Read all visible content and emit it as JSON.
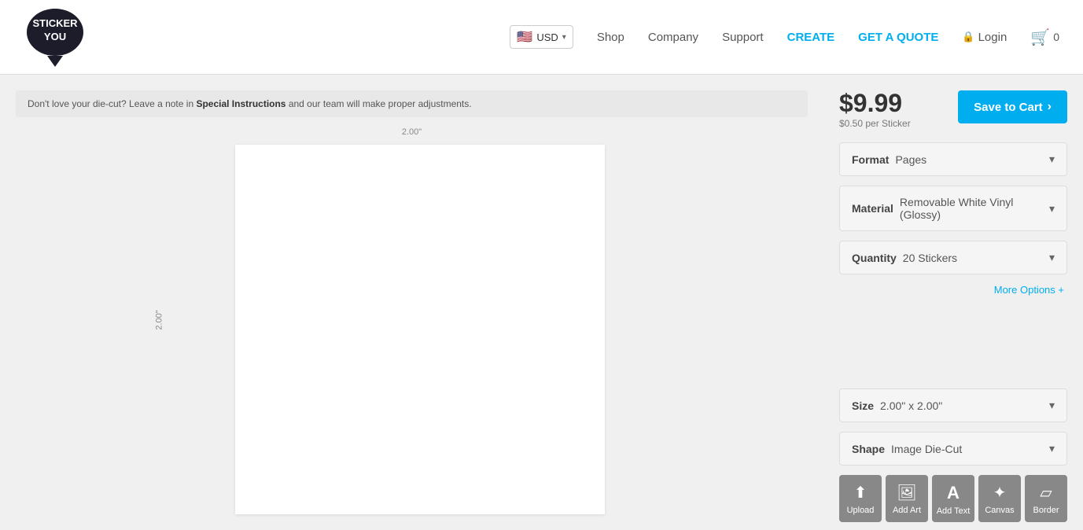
{
  "header": {
    "currency": "USD",
    "flag": "🇺🇸",
    "nav": {
      "shop": "Shop",
      "company": "Company",
      "support": "Support",
      "create": "CREATE",
      "quote": "GET A QUOTE",
      "login": "Login",
      "cart_count": "0"
    }
  },
  "notice": {
    "text_before": "Don't love your die-cut?",
    "text_middle_prefix": " Leave a note in ",
    "text_highlight": "Special Instructions",
    "text_after": " and our team will make proper adjustments."
  },
  "canvas": {
    "ruler_top": "2.00\"",
    "ruler_left": "2.00\""
  },
  "pricing": {
    "price": "$9.99",
    "per_sticker": "$0.50 per Sticker",
    "save_button": "Save to Cart"
  },
  "options": {
    "format_label": "Format",
    "format_value": "Pages",
    "material_label": "Material",
    "material_value": "Removable White Vinyl (Glossy)",
    "quantity_label": "Quantity",
    "quantity_value": "20 Stickers",
    "more_options": "More Options +",
    "size_label": "Size",
    "size_value": "2.00\" x 2.00\"",
    "shape_label": "Shape",
    "shape_value": "Image Die-Cut"
  },
  "toolbar": {
    "tools": [
      {
        "id": "upload",
        "label": "Upload",
        "icon": "⬆"
      },
      {
        "id": "add-art",
        "label": "Add Art",
        "icon": "🖼"
      },
      {
        "id": "add-text",
        "label": "Add Text",
        "icon": "A"
      },
      {
        "id": "canvas",
        "label": "Canvas",
        "icon": "✦"
      },
      {
        "id": "border",
        "label": "Border",
        "icon": "▱"
      }
    ]
  }
}
